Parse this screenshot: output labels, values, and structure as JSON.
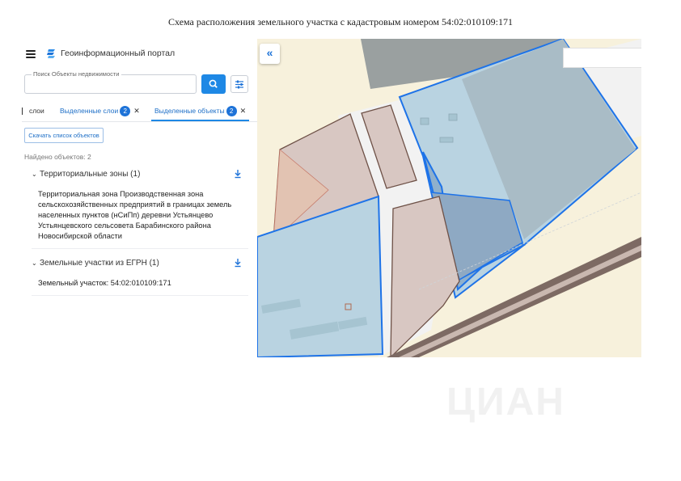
{
  "document": {
    "title": "Схема расположения земельного участка с кадастровым номером 54:02:010109:171"
  },
  "app": {
    "menu_icon": "hamburger-menu-icon",
    "logo_icon": "portal-logo-icon",
    "title": "Геоинформационный портал"
  },
  "search": {
    "label": "Поиск Объекты недвижимости",
    "value": "",
    "search_icon": "search-icon",
    "filter_icon": "filter-settings-icon"
  },
  "tabs": [
    {
      "label": "слои",
      "badge": "",
      "active": false
    },
    {
      "label": "Выделенные слои",
      "badge": "2",
      "active": false
    },
    {
      "label": "Выделенные объекты",
      "badge": "2",
      "active": true
    }
  ],
  "actions": {
    "download_list": "Скачать список объектов"
  },
  "results": {
    "found": "Найдено объектов: 2",
    "sections": [
      {
        "title": "Территориальные зоны (1)",
        "body": "Территориальная зона Производственная зона сельскохозяйственных предприятий в границах земель населенных пунктов (нСиПп) деревни Устьянцево Устьянцевского сельсовета Барабинского района Новосибирской области",
        "download_icon": "download-icon"
      },
      {
        "title": "Земельные участки из ЕГРН (1)",
        "body": "Земельный участок: 54:02:010109:171",
        "download_icon": "download-icon"
      }
    ]
  },
  "map": {
    "collapse_icon": "double-chevron-left-icon",
    "colors": {
      "background": "#f7f1dc",
      "zone": "#b9d3e1",
      "zone_border": "#1e73e8",
      "selected_parcel": "#8fb0cc",
      "parcel": "#d8c7c2",
      "parcel_border": "#6e5147",
      "road": "#f2f2f2",
      "dark_block": "#9aa0a0"
    }
  },
  "watermark": "ЦИАН"
}
